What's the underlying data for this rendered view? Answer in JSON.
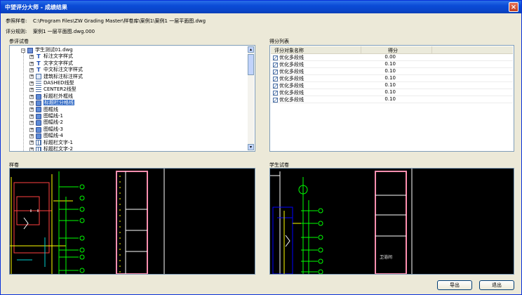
{
  "window": {
    "title": "中望评分大师 - 成绩结果"
  },
  "info": {
    "ref_label": "参照样卷:",
    "ref_value": "C:\\Program Files\\ZW Grading Master\\样卷库\\案例1\\案例1 一层平面图.dwg",
    "rule_label": "评分规则:",
    "rule_value": "案例1 一层平面图.dwg.000"
  },
  "tree": {
    "title": "参评试卷",
    "root": "学生测试01.dwg",
    "items": [
      {
        "label": "标注文字样式",
        "icon": "text-style-icon"
      },
      {
        "label": "文字文字样式",
        "icon": "text-style-icon"
      },
      {
        "label": "中文标注文字样式",
        "icon": "text-style-icon"
      },
      {
        "label": "建筑标注标注样式",
        "icon": "dim-style-icon"
      },
      {
        "label": "DASHED线型",
        "icon": "linetype-icon"
      },
      {
        "label": "CENTER2线型",
        "icon": "linetype-icon"
      },
      {
        "label": "标题栏外框线",
        "icon": "block-icon"
      },
      {
        "label": "标题栏分格线",
        "icon": "block-icon"
      },
      {
        "label": "图框线",
        "icon": "block-icon"
      },
      {
        "label": "图幅线-1",
        "icon": "block-icon"
      },
      {
        "label": "图幅线-2",
        "icon": "block-icon"
      },
      {
        "label": "图幅线-3",
        "icon": "block-icon"
      },
      {
        "label": "图幅线-4",
        "icon": "block-icon"
      },
      {
        "label": "标题栏文字-1",
        "icon": "grid-icon"
      },
      {
        "label": "标题栏文字-2",
        "icon": "grid-icon"
      }
    ],
    "selected_index": 7
  },
  "scores": {
    "title": "得分列表",
    "col_name": "评分对象名称",
    "col_score": "得分",
    "rows": [
      {
        "name": "优化多段线",
        "score": "0.00"
      },
      {
        "name": "优化多段线",
        "score": "0.10"
      },
      {
        "name": "优化多段线",
        "score": "0.10"
      },
      {
        "name": "优化多段线",
        "score": "0.10"
      },
      {
        "name": "优化多段线",
        "score": "0.10"
      },
      {
        "name": "优化多段线",
        "score": "0.10"
      },
      {
        "name": "优化多段线",
        "score": "0.10"
      }
    ]
  },
  "sample": {
    "title": "样卷"
  },
  "student": {
    "title": "学生试卷",
    "room_label": "卫浴间"
  },
  "buttons": {
    "export": "导出",
    "exit": "退出"
  },
  "colors": {
    "titlebar": "#0a4bd6",
    "cad_bg": "#000000",
    "selection": "#316ac5",
    "cad_frame_pink": "#ff8fb0"
  }
}
